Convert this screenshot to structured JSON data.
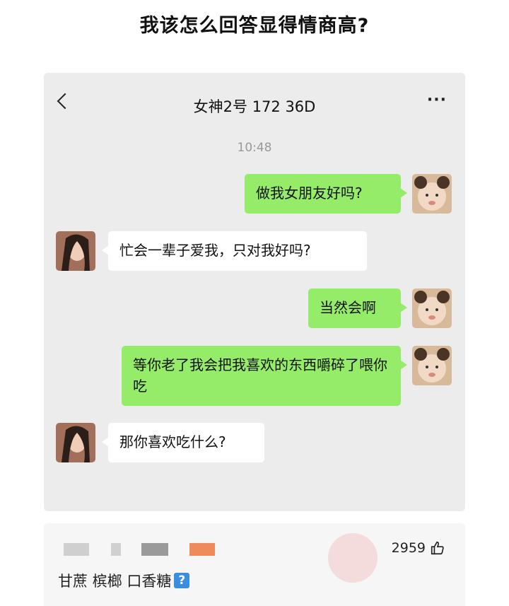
{
  "page_title": "我该怎么回答显得情商高?",
  "chat": {
    "contact_name": "女神2号 172 36D",
    "back_icon": "chevron-left-icon",
    "more_icon": "ellipsis-icon",
    "timestamp": "10:48",
    "messages": [
      {
        "sender": "me",
        "text": "做我女朋友好吗?"
      },
      {
        "sender": "her",
        "text": "忙会一辈子爱我，只对我好吗?"
      },
      {
        "sender": "me",
        "text": "当然会啊"
      },
      {
        "sender": "me",
        "text": "等你老了我会把我喜欢的东西嚼碎了喂你吃"
      },
      {
        "sender": "her",
        "text": "那你喜欢吃什么?"
      }
    ],
    "colors": {
      "my_bubble": "#95ec69",
      "her_bubble": "#ffffff",
      "background": "#ececec"
    }
  },
  "comment": {
    "like_count": "2959",
    "like_icon": "thumbs-up-icon",
    "text": "甘蔗 槟榔 口香糖",
    "emoji": "?"
  }
}
